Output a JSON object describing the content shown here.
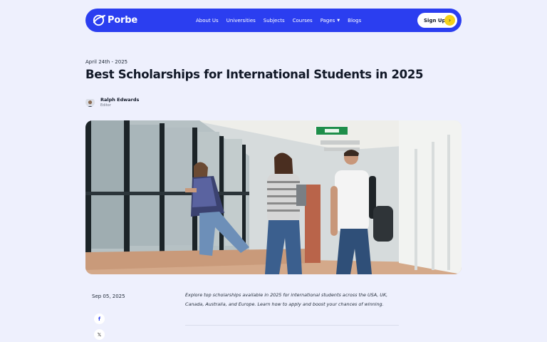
{
  "header": {
    "logo_text": "Porbe",
    "nav": [
      "About Us",
      "Universities",
      "Subjects",
      "Courses",
      "Pages",
      "Blogs"
    ],
    "signup_label": "Sign Up"
  },
  "article": {
    "date_top": "April 24th - 2025",
    "title": "Best Scholarships for International Students in 2025",
    "author_name": "Ralph Edwards",
    "author_role": "Editor",
    "post_date": "Sep 05, 2025",
    "excerpt": "Explore top scholarships available in 2025 for international students across the USA, UK, Canada, Australia, and Europe. Learn how to apply and boost your chances of winning."
  },
  "social": {
    "facebook": "f",
    "x": "𝕏"
  },
  "colors": {
    "brand": "#2b3ef0",
    "accent": "#f5d21a",
    "background": "#eef0fd"
  },
  "icons": {
    "logo": "globe-plane-icon",
    "caret": "chevron-down-icon",
    "signup": "arrow-right-icon"
  }
}
